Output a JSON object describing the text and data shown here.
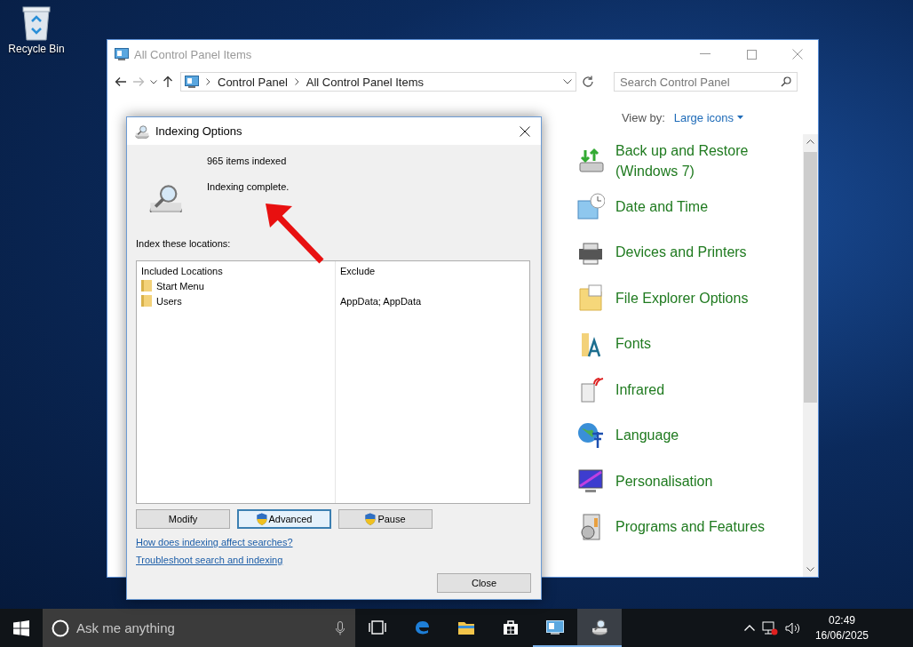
{
  "desktop_icons": [
    {
      "label": "Recycle Bin"
    }
  ],
  "control_panel": {
    "title": "All Control Panel Items",
    "breadcrumb": [
      "Control Panel",
      "All Control Panel Items"
    ],
    "search": {
      "placeholder": "Search Control Panel"
    },
    "view_by": {
      "label": "View by:",
      "value": "Large icons"
    },
    "items": [
      {
        "label": "Back up and Restore (Windows 7)"
      },
      {
        "label": "Date and Time"
      },
      {
        "label": "Devices and Printers"
      },
      {
        "label": "File Explorer Options"
      },
      {
        "label": "Fonts"
      },
      {
        "label": "Infrared"
      },
      {
        "label": "Language"
      },
      {
        "label": "Personalisation"
      },
      {
        "label": "Programs and Features"
      }
    ]
  },
  "dialog": {
    "title": "Indexing Options",
    "status": {
      "count": "965 items indexed",
      "message": "Indexing complete."
    },
    "locations_label": "Index these locations:",
    "table": {
      "columns": [
        "Included Locations",
        "Exclude"
      ],
      "rows": [
        {
          "location": "Start Menu"
        },
        {
          "location": "Users",
          "exclude": "AppData; AppData"
        }
      ]
    },
    "buttons": [
      {
        "label": "Modify",
        "kind": "plain",
        "focused": false
      },
      {
        "label": "Advanced",
        "kind": "shield",
        "focused": true
      },
      {
        "label": "Pause",
        "kind": "shield",
        "focused": false
      }
    ],
    "links": [
      "How does indexing affect searches?",
      "Troubleshoot search and indexing"
    ],
    "close_button": "Close"
  },
  "taskbar": {
    "search_placeholder": "Ask me anything",
    "apps": [
      {
        "kind": "taskview",
        "running": false,
        "selected": false
      },
      {
        "kind": "edge",
        "running": false,
        "selected": false
      },
      {
        "kind": "explorer",
        "running": false,
        "selected": false
      },
      {
        "kind": "store",
        "running": false,
        "selected": false
      },
      {
        "kind": "controlpanel",
        "running": true,
        "selected": false
      },
      {
        "kind": "indexing",
        "running": true,
        "selected": true
      }
    ],
    "clock": {
      "time": "02:49",
      "date": "16/06/2025"
    }
  }
}
